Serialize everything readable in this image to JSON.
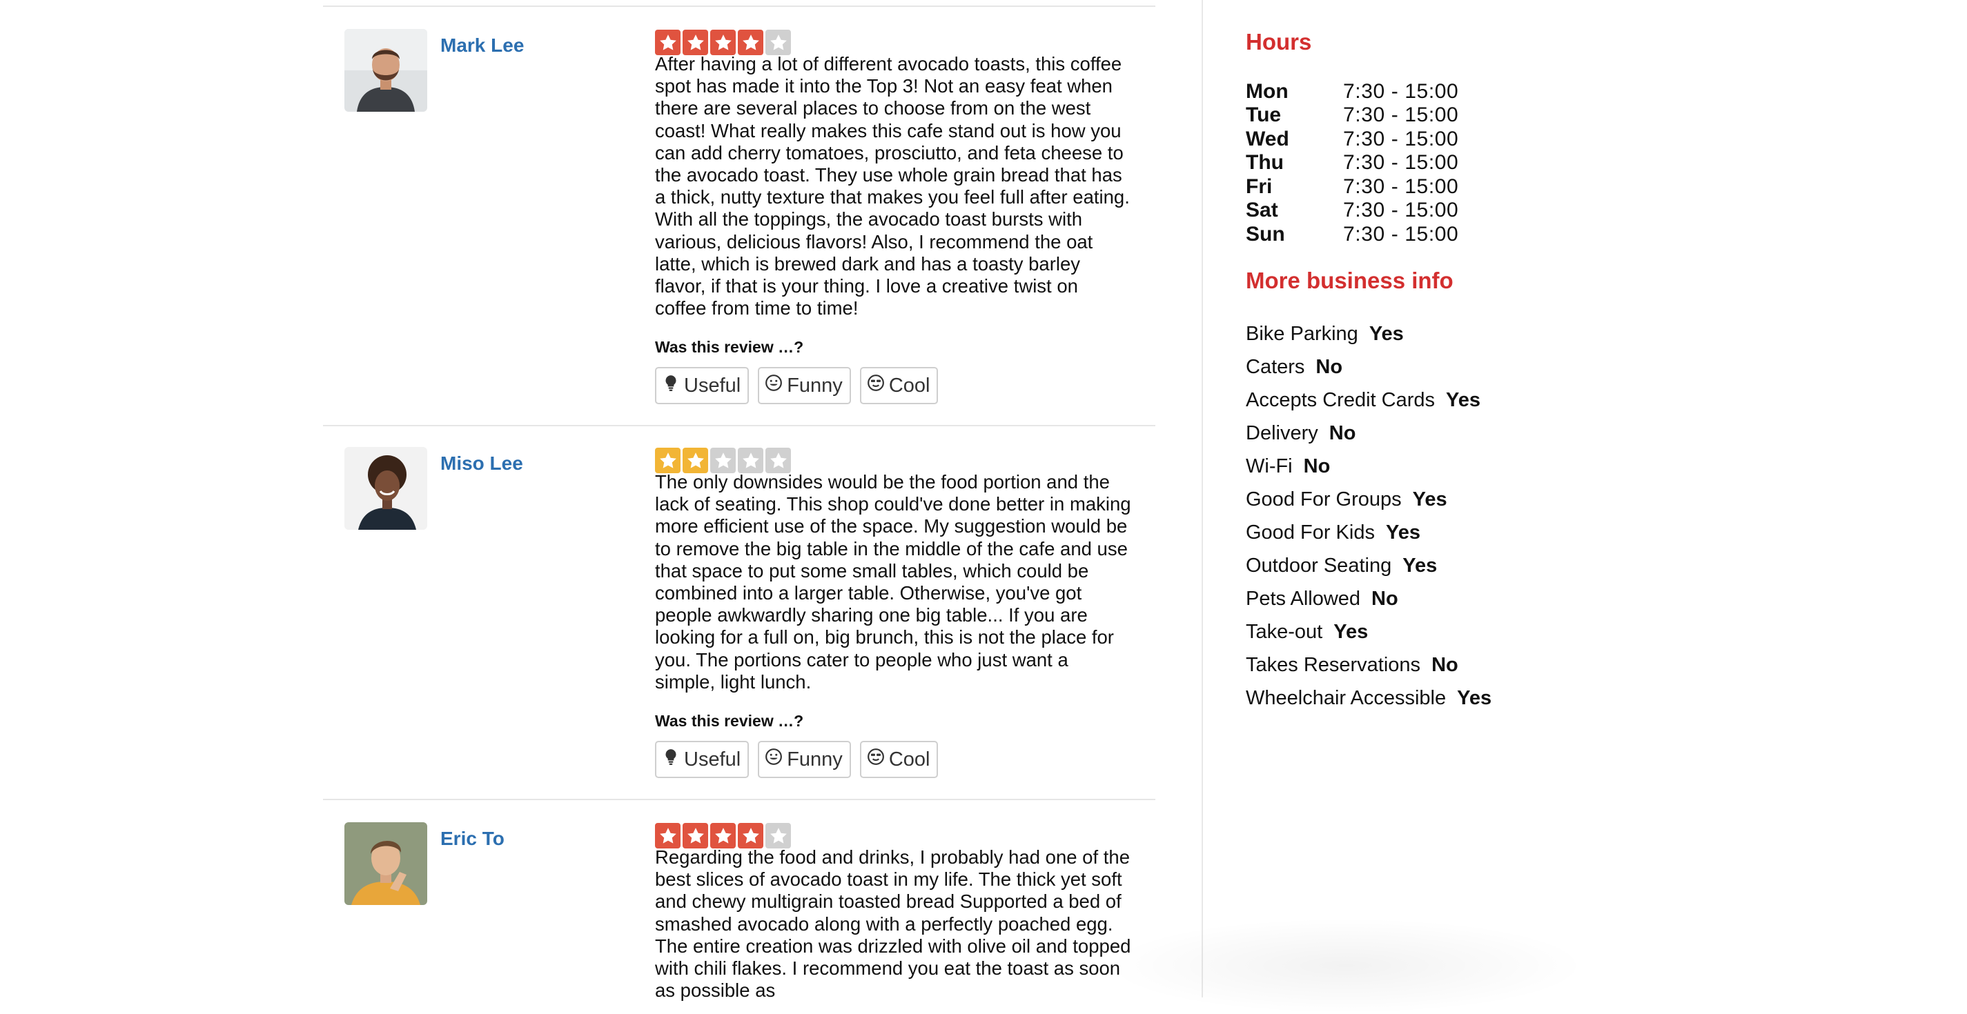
{
  "reviews": [
    {
      "author": "Mark Lee",
      "rating": 4,
      "star_color": "#e0533f",
      "text": "After having a lot of different avocado toasts, this coffee spot has made it into the Top 3! Not an easy feat when there are several places to choose from on the west coast! What really makes this cafe stand out is how you can add cherry tomatoes, prosciutto, and feta cheese to the avocado toast. They use whole grain bread that has a thick, nutty texture that makes you feel full after eating. With all the toppings, the avocado toast bursts with various, delicious flavors! Also, I recommend the oat latte, which is brewed dark and has a toasty barley flavor, if that is your thing. I love a creative twist on coffee from time to time!",
      "question": "Was this review …?",
      "votes": [
        "Useful",
        "Funny",
        "Cool"
      ]
    },
    {
      "author": "Miso Lee",
      "rating": 2,
      "star_color": "#f2b535",
      "text": "The only downsides would be the food portion and the lack of seating. This shop could've done better in making more efficient use of the space. My suggestion would be to remove the big table in the middle of the cafe and use that space to put some small tables, which could be combined into a larger table. Otherwise, you've got people awkwardly sharing one big table... If you are looking for a full on, big brunch, this is not the place for you. The portions cater to people who just want a simple, light lunch.",
      "question": "Was this review …?",
      "votes": [
        "Useful",
        "Funny",
        "Cool"
      ]
    },
    {
      "author": "Eric To",
      "rating": 4,
      "star_color": "#e0533f",
      "text": "Regarding the food and drinks, I probably had one of the best slices of avocado toast in my life. The thick yet soft and chewy multigrain toasted bread Supported a bed of smashed avocado along with a perfectly poached egg. The entire creation was drizzled with olive oil and topped with chili flakes. I recommend you eat the toast as soon as possible as"
    }
  ],
  "hours": {
    "title": "Hours",
    "rows": [
      {
        "day": "Mon",
        "time": "7:30 - 15:00"
      },
      {
        "day": "Tue",
        "time": "7:30 - 15:00"
      },
      {
        "day": "Wed",
        "time": "7:30 - 15:00"
      },
      {
        "day": "Thu",
        "time": "7:30 - 15:00"
      },
      {
        "day": "Fri",
        "time": "7:30 - 15:00"
      },
      {
        "day": "Sat",
        "time": "7:30 - 15:00"
      },
      {
        "day": "Sun",
        "time": "7:30 - 15:00"
      }
    ]
  },
  "business_info": {
    "title": "More business info",
    "items": [
      {
        "label": "Bike Parking",
        "value": "Yes"
      },
      {
        "label": "Caters",
        "value": "No"
      },
      {
        "label": "Accepts Credit Cards",
        "value": "Yes"
      },
      {
        "label": "Delivery",
        "value": "No"
      },
      {
        "label": "Wi-Fi",
        "value": "No"
      },
      {
        "label": "Good For Groups",
        "value": "Yes"
      },
      {
        "label": "Good For Kids",
        "value": "Yes"
      },
      {
        "label": "Outdoor Seating",
        "value": "Yes"
      },
      {
        "label": "Pets Allowed",
        "value": "No"
      },
      {
        "label": "Take-out",
        "value": "Yes"
      },
      {
        "label": "Takes Reservations",
        "value": "No"
      },
      {
        "label": "Wheelchair Accessible",
        "value": "Yes"
      }
    ]
  },
  "colors": {
    "link": "#2c6fb0",
    "heading": "#d32f2f",
    "star_empty": "#d0d0d0"
  },
  "icons": {
    "useful": "lightbulb-icon",
    "funny": "smiley-icon",
    "cool": "cool-face-icon"
  }
}
